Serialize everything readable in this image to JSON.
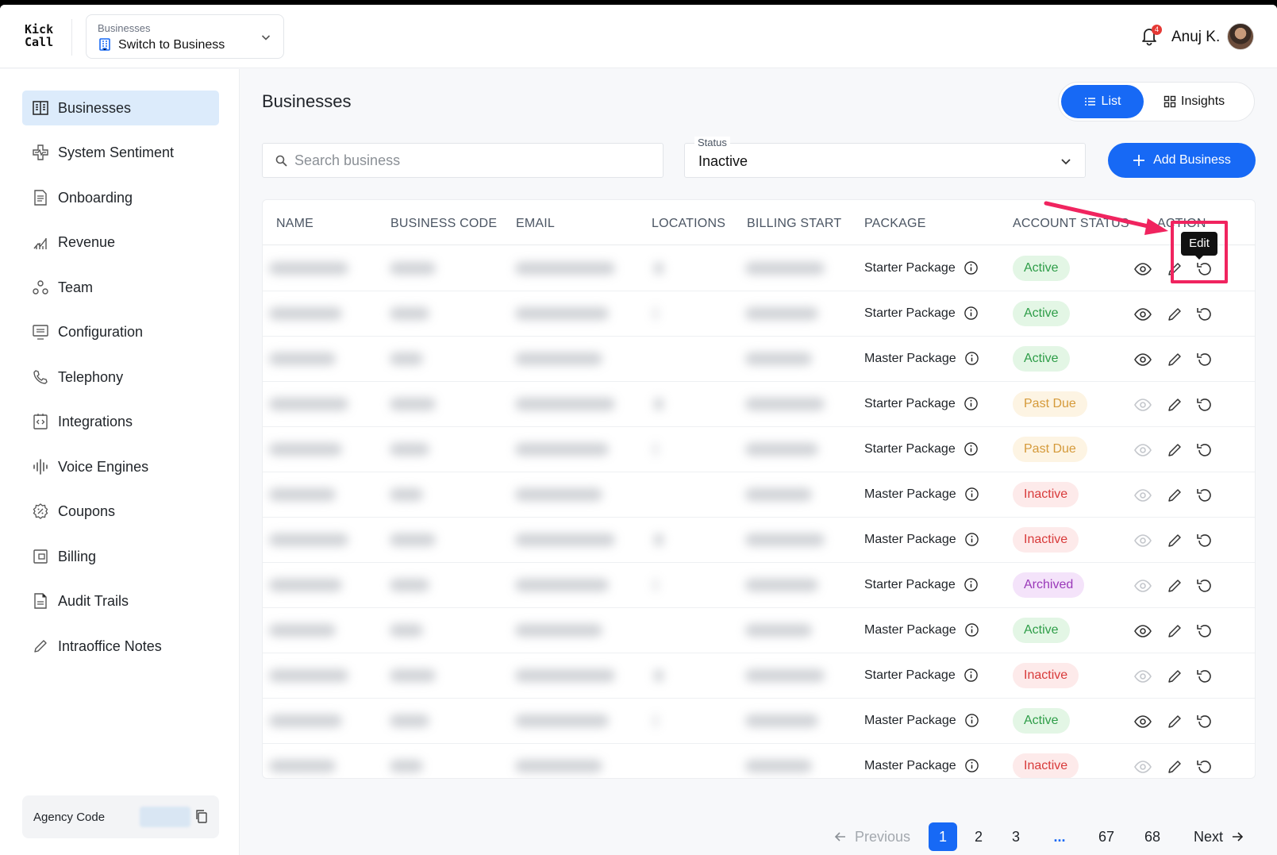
{
  "header": {
    "logo_line1": "Kick",
    "logo_line2": "Call",
    "switcher_label": "Businesses",
    "switcher_value": "Switch to Business",
    "notification_count": "4",
    "user_name": "Anuj K."
  },
  "sidebar": {
    "items": [
      {
        "label": "Businesses",
        "icon": "building-icon",
        "active": true
      },
      {
        "label": "System Sentiment",
        "icon": "heart-pulse-icon"
      },
      {
        "label": "Onboarding",
        "icon": "document-icon"
      },
      {
        "label": "Revenue",
        "icon": "chart-icon"
      },
      {
        "label": "Team",
        "icon": "team-icon"
      },
      {
        "label": "Configuration",
        "icon": "monitor-settings-icon"
      },
      {
        "label": "Telephony",
        "icon": "phone-icon"
      },
      {
        "label": "Integrations",
        "icon": "code-file-icon"
      },
      {
        "label": "Voice Engines",
        "icon": "waveform-icon"
      },
      {
        "label": "Coupons",
        "icon": "coupon-icon"
      },
      {
        "label": "Billing",
        "icon": "wallet-icon"
      },
      {
        "label": "Audit Trails",
        "icon": "audit-file-icon"
      },
      {
        "label": "Intraoffice Notes",
        "icon": "pencil-icon"
      }
    ],
    "agency_label": "Agency Code"
  },
  "main": {
    "title": "Businesses",
    "view_toggle": {
      "list": "List",
      "insights": "Insights"
    },
    "search_placeholder": "Search business",
    "status_label": "Status",
    "status_value": "Inactive",
    "add_button": "Add Business",
    "columns": [
      "NAME",
      "BUSINESS CODE",
      "EMAIL",
      "LOCATIONS",
      "BILLING START",
      "PACKAGE",
      "ACCOUNT STATUS",
      "ACTION"
    ],
    "rows": [
      {
        "package": "Starter Package",
        "status": "Active"
      },
      {
        "package": "Starter Package",
        "status": "Active"
      },
      {
        "package": "Master Package",
        "status": "Active"
      },
      {
        "package": "Starter Package",
        "status": "Past Due"
      },
      {
        "package": "Starter Package",
        "status": "Past Due"
      },
      {
        "package": "Master Package",
        "status": "Inactive"
      },
      {
        "package": "Master Package",
        "status": "Inactive"
      },
      {
        "package": "Starter Package",
        "status": "Archived"
      },
      {
        "package": "Master Package",
        "status": "Active"
      },
      {
        "package": "Starter Package",
        "status": "Inactive"
      },
      {
        "package": "Master Package",
        "status": "Active"
      },
      {
        "package": "Master Package",
        "status": "Inactive"
      }
    ],
    "tooltip": "Edit"
  },
  "pagination": {
    "previous": "Previous",
    "pages": [
      "1",
      "2",
      "3",
      "...",
      "67",
      "68"
    ],
    "current": "1",
    "next": "Next"
  },
  "colors": {
    "accent": "#1769f5",
    "active": "#2e9d48",
    "past_due": "#d59a3a",
    "inactive": "#d83a3a",
    "archived": "#9a39b9",
    "annotation": "#f0245f"
  }
}
